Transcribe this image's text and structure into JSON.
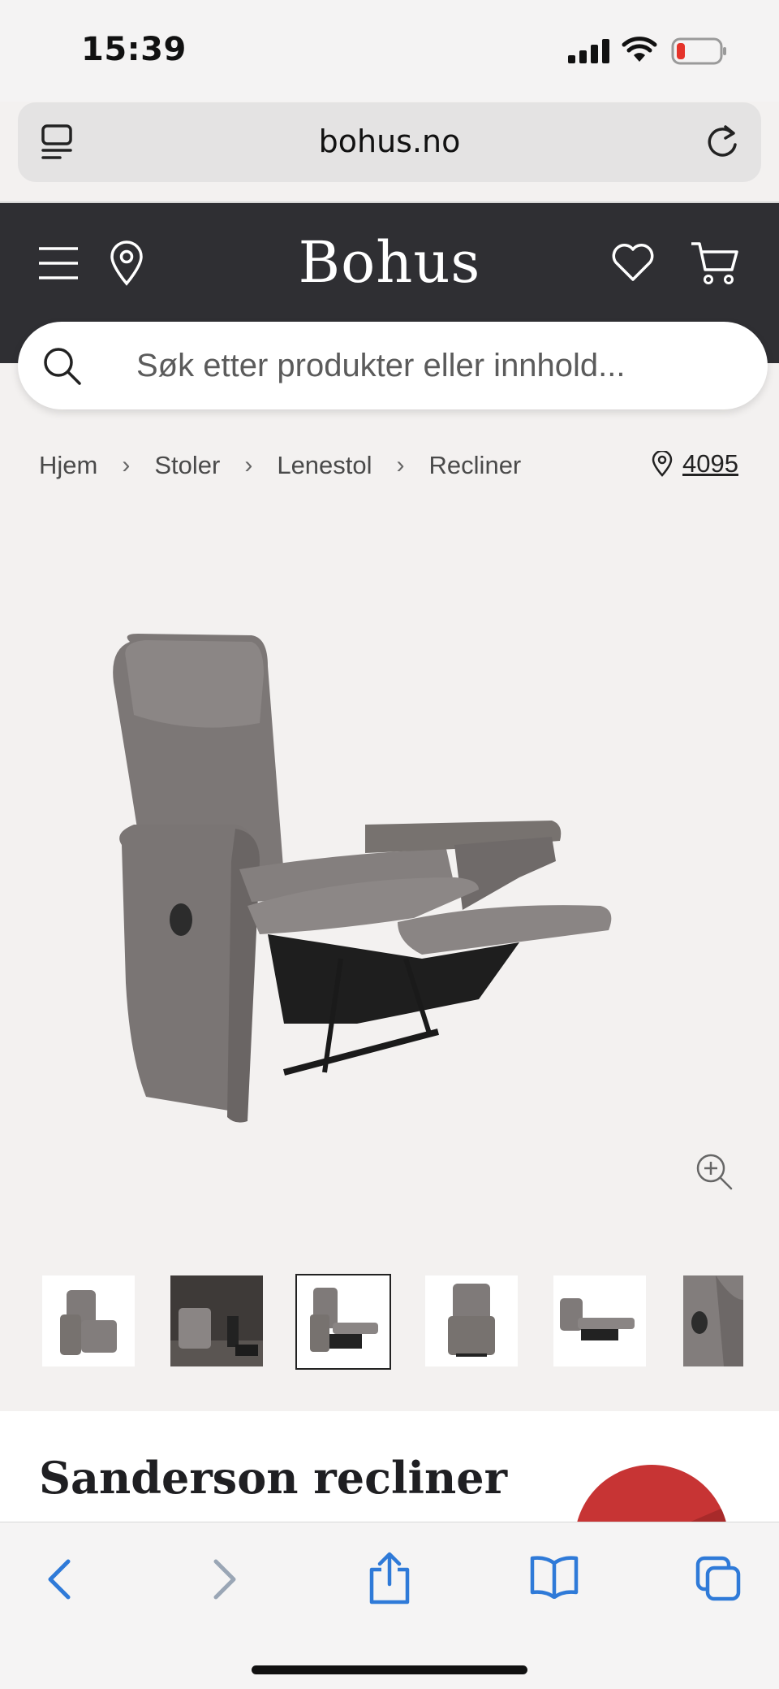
{
  "status_bar": {
    "time": "15:39"
  },
  "browser": {
    "url": "bohus.no"
  },
  "site": {
    "logo": "Bohus",
    "search_placeholder": "Søk etter produkter eller innhold..."
  },
  "breadcrumb": {
    "items": [
      "Hjem",
      "Stoler",
      "Lenestol",
      "Recliner"
    ],
    "store_number": "4095"
  },
  "gallery": {
    "thumbnail_count": 6,
    "active_index": 2
  },
  "product": {
    "title": "Sanderson recliner"
  },
  "colors": {
    "header_bg": "#2f2f33",
    "badge": "#c73434",
    "safari_blue": "#2f7ad8"
  }
}
